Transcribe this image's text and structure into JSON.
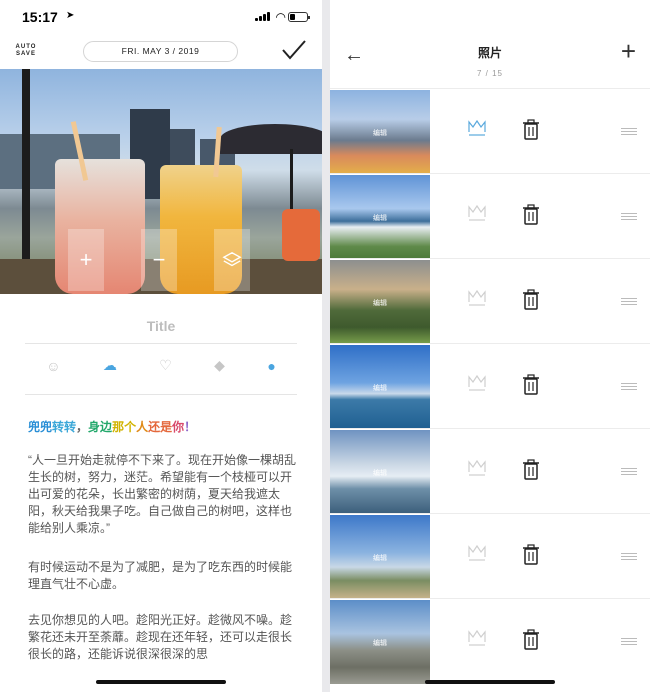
{
  "status": {
    "time": "15:17"
  },
  "editor": {
    "autosave": "AUTO SAVE",
    "date": "FRI. MAY 3 / 2019",
    "title_placeholder": "Title",
    "rainbow_text": [
      {
        "t": "兜兜",
        "c": "#2a8fd6"
      },
      {
        "t": "转转",
        "c": "#3aa7d8"
      },
      {
        "t": "，",
        "c": "#6a6a6a"
      },
      {
        "t": "身边",
        "c": "#23a86b"
      },
      {
        "t": "那个",
        "c": "#d1b300"
      },
      {
        "t": "人",
        "c": "#e08a18"
      },
      {
        "t": "还是",
        "c": "#e4683c"
      },
      {
        "t": "你",
        "c": "#d8496b"
      },
      {
        "t": "！",
        "c": "#8d66c9"
      }
    ],
    "paragraphs": [
      "“人一旦开始走就停不下来了。现在开始像一棵胡乱生长的树，努力，迷茫。希望能有一个枝桠可以开出可爱的花朵，长出繁密的树荫，夏天给我遮太阳，秋天给我果子吃。自己做自己的树吧，这样也能给别人乘凉。”",
      "有时候运动不是为了减肥，是为了吃东西的时候能理直气壮不心虚。",
      "去见你想见的人吧。趁阳光正好。趁微风不噪。趁繁花还未开至荼蘼。趁现在还年轻，还可以走很长很长的路，还能诉说很深很深的思"
    ]
  },
  "photos_page": {
    "title": "照片",
    "count": "7 / 15",
    "edit_label": "编辑",
    "rows": [
      {
        "primary": true,
        "bg": "linear-gradient(180deg,#8db3e0 0%,#b8cde8 35%,#6b7b8e 60%,#d98a5c 78%,#e4b04a 100%)"
      },
      {
        "primary": false,
        "bg": "linear-gradient(180deg,#5f93d6 0%,#a9c8ee 40%,#3d6e9a 55%,#e9eef3 62%,#5f8a4a 85%,#4c7a3a 100%)"
      },
      {
        "primary": false,
        "bg": "linear-gradient(180deg,#8d8f8f 0%,#c9b08a 35%,#4f6a3a 60%,#3e5a2d 80%,#7aa04c 100%)"
      },
      {
        "primary": false,
        "bg": "linear-gradient(180deg,#2f6fc7 0%,#6ea3e1 45%,#c9d9ea 58%,#3c7aa8 65%,#1f5f91 100%)"
      },
      {
        "primary": false,
        "bg": "linear-gradient(180deg,#6f93c1 0%,#c9d6e4 40%,#e6edf4 55%,#6e8fa8 70%,#3a5d7a 100%)"
      },
      {
        "primary": false,
        "bg": "linear-gradient(180deg,#3d78c9 0%,#8bb3e0 45%,#c8d8e6 62%,#7a8d62 78%,#c9b48c 100%)"
      },
      {
        "primary": false,
        "bg": "linear-gradient(180deg,#5c8ec8 0%,#a9c3e0 40%,#8c8f86 60%,#6d6f64 80%,#9a9b92 100%)"
      }
    ]
  }
}
